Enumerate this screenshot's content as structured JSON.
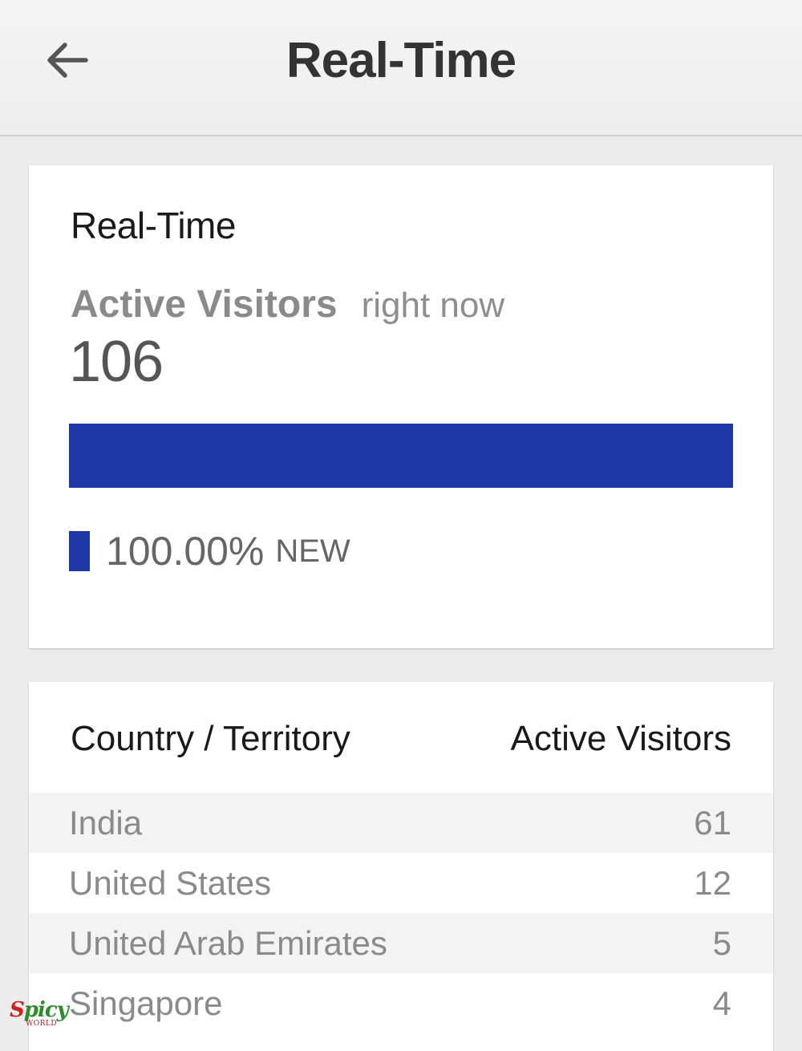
{
  "header": {
    "title": "Real-Time",
    "back_icon": "arrow-left-icon"
  },
  "summary": {
    "card_title": "Real-Time",
    "metric_label": "Active Visitors",
    "metric_sub": "right now",
    "active_visitors": "106",
    "new_fraction": 1.0,
    "legend_percent": "100.00%",
    "legend_tag": "NEW",
    "bar_color": "#1e37a6"
  },
  "table": {
    "columns": [
      "Country / Territory",
      "Active Visitors"
    ],
    "rows": [
      {
        "country": "India",
        "visitors": "61"
      },
      {
        "country": "United States",
        "visitors": "12"
      },
      {
        "country": "United Arab Emirates",
        "visitors": "5"
      },
      {
        "country": "Singapore",
        "visitors": "4"
      }
    ]
  },
  "watermark": {
    "text": "Spicy",
    "sub": "WORLD"
  }
}
